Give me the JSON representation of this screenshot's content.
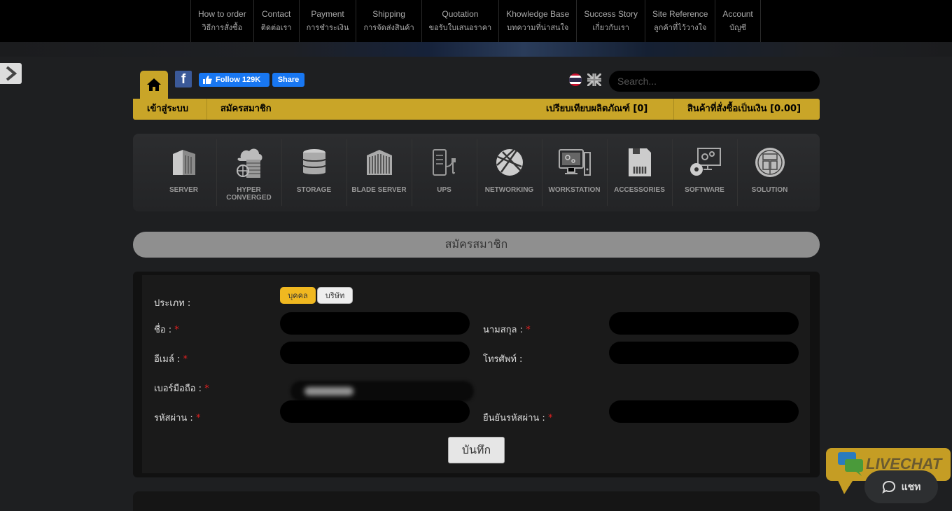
{
  "topnav": [
    {
      "en": "How to order",
      "th": "วิธีการสั่งซื้อ"
    },
    {
      "en": "Contact",
      "th": "ติดต่อเรา"
    },
    {
      "en": "Payment",
      "th": "การชำระเงิน"
    },
    {
      "en": "Shipping",
      "th": "การจัดส่งสินค้า"
    },
    {
      "en": "Quotation",
      "th": "ขอรับใบเสนอราคา"
    },
    {
      "en": "Khowledge Base",
      "th": "บทความที่น่าสนใจ"
    },
    {
      "en": "Success Story",
      "th": "เกี่ยวกับเรา"
    },
    {
      "en": "Site Reference",
      "th": "ลูกค้าที่ไว้วางใจ"
    },
    {
      "en": "Account",
      "th": "บัญชี"
    }
  ],
  "social": {
    "facebook_letter": "f",
    "follow_label": "Follow 129K",
    "share_label": "Share"
  },
  "search": {
    "placeholder": "Search..."
  },
  "goldbar": {
    "login": "เข้าสู่ระบบ",
    "register": "สมัครสมาชิก",
    "compare": "เปรียบเทียบผลิตภัณฑ์ [0]",
    "cart": "สินค้าที่สั่งซื้อเป็นเงิน [0.00]"
  },
  "categories": [
    {
      "label": "SERVER",
      "icon": "server-icon"
    },
    {
      "label": "HYPER\nCONVERGED",
      "icon": "hyper-converged-icon"
    },
    {
      "label": "STORAGE",
      "icon": "storage-icon"
    },
    {
      "label": "BLADE SERVER",
      "icon": "blade-server-icon"
    },
    {
      "label": "UPS",
      "icon": "ups-icon"
    },
    {
      "label": "NETWORKING",
      "icon": "networking-icon"
    },
    {
      "label": "WORKSTATION",
      "icon": "workstation-icon"
    },
    {
      "label": "ACCESSORIES",
      "icon": "accessories-icon"
    },
    {
      "label": "SOFTWARE",
      "icon": "software-icon"
    },
    {
      "label": "SOLUTION",
      "icon": "solution-icon"
    }
  ],
  "section_title": "สมัครสมาชิก",
  "form": {
    "type_label": "ประเภท :",
    "type_individual": "บุคคล",
    "type_company": "บริษัท",
    "first_name_label": "ชื่อ :",
    "last_name_label": "นามสกุล :",
    "email_label": "อีเมล์ :",
    "phone_label": "โทรศัพท์ :",
    "mobile_label": "เบอร์มือถือ :",
    "password_label": "รหัสผ่าน :",
    "confirm_password_label": "ยืนยันรหัสผ่าน :",
    "required_mark": "*",
    "save_label": "บันทึก"
  },
  "livechat": {
    "brand": "LIVECHAT",
    "chat_label": "แชท"
  },
  "colors": {
    "gold": "#c9a528",
    "background": "#1e1f21",
    "required": "#e02020"
  }
}
